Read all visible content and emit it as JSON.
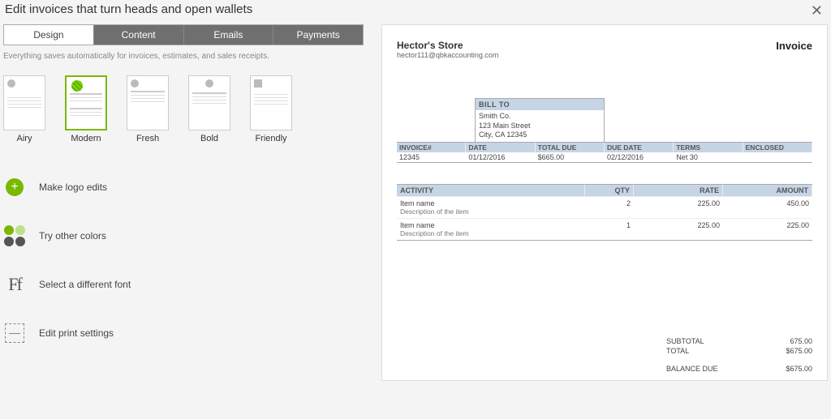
{
  "header": {
    "title": "Edit invoices that turn heads and open wallets"
  },
  "tabs": [
    "Design",
    "Content",
    "Emails",
    "Payments"
  ],
  "active_tab_index": 0,
  "autosave_text": "Everything saves automatically for invoices, estimates, and sales receipts.",
  "templates": [
    {
      "name": "Airy"
    },
    {
      "name": "Modern"
    },
    {
      "name": "Fresh"
    },
    {
      "name": "Bold"
    },
    {
      "name": "Friendly"
    }
  ],
  "selected_template_index": 1,
  "options": {
    "logo": "Make logo edits",
    "colors": "Try other colors",
    "font": "Select a different font",
    "print": "Edit print settings"
  },
  "invoice": {
    "store_name": "Hector's Store",
    "store_email": "hector111@qbkaccounting.com",
    "doc_label": "Invoice",
    "bill_to_label": "BILL TO",
    "bill_to": {
      "name": "Smith Co.",
      "street": "123 Main Street",
      "city": "City, CA 12345"
    },
    "info_columns": [
      {
        "label": "INVOICE#",
        "value": "12345"
      },
      {
        "label": "DATE",
        "value": "01/12/2016"
      },
      {
        "label": "TOTAL DUE",
        "value": "$665.00"
      },
      {
        "label": "DUE DATE",
        "value": "02/12/2016"
      },
      {
        "label": "TERMS",
        "value": "Net 30"
      },
      {
        "label": "ENCLOSED",
        "value": ""
      }
    ],
    "line_headers": {
      "activity": "ACTIVITY",
      "qty": "QTY",
      "rate": "RATE",
      "amount": "AMOUNT"
    },
    "lines": [
      {
        "name": "Item name",
        "desc": "Description of the item",
        "qty": "2",
        "rate": "225.00",
        "amount": "450.00"
      },
      {
        "name": "Item name",
        "desc": "Description of the item",
        "qty": "1",
        "rate": "225.00",
        "amount": "225.00"
      }
    ],
    "subtotal_label": "SUBTOTAL",
    "subtotal": "675.00",
    "total_label": "TOTAL",
    "total": "$675.00",
    "balance_label": "BALANCE DUE",
    "balance": "$675.00"
  },
  "color_swatches": [
    "#7ab800",
    "#9c9",
    "#555",
    "#555"
  ]
}
